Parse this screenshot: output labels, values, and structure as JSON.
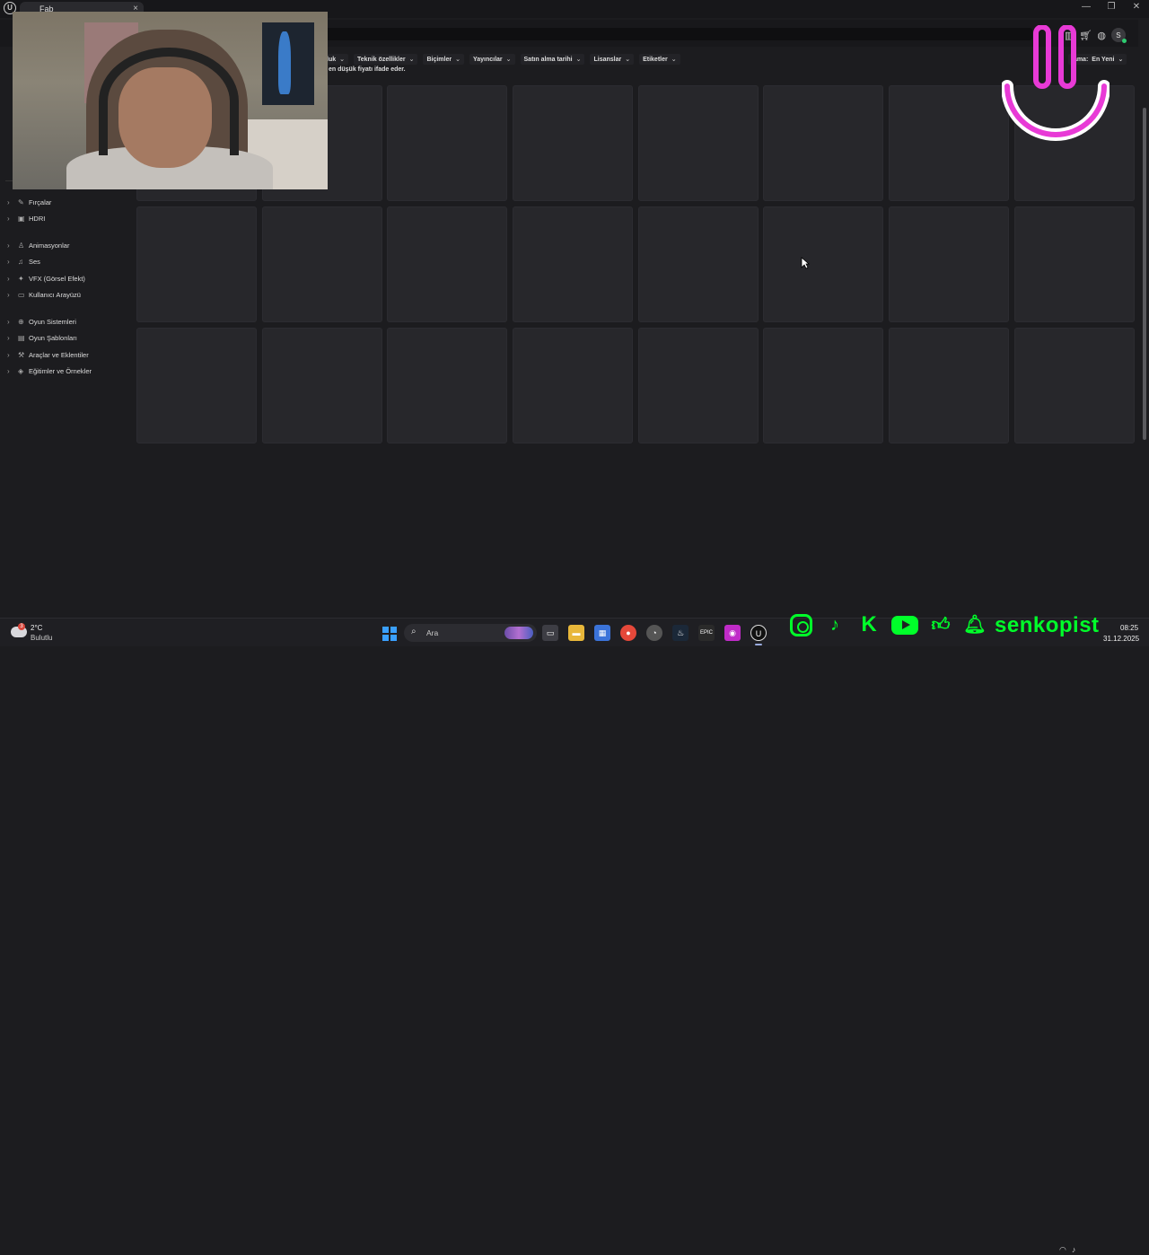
{
  "window": {
    "tab_title": "Fab",
    "tab_close": "×",
    "logo_text": "U",
    "controls": {
      "minimize": "—",
      "restore": "❐",
      "close": "✕"
    }
  },
  "header": {
    "icons": [
      "library-icon",
      "cart-icon",
      "globe-icon"
    ],
    "avatar_initial": "s"
  },
  "filters": [
    {
      "label": "luk"
    },
    {
      "label": "Teknik özellikler"
    },
    {
      "label": "Biçimler"
    },
    {
      "label": "Yayıncılar"
    },
    {
      "label": "Satın alma tarihi"
    },
    {
      "label": "Lisanslar"
    },
    {
      "label": "Etiketler"
    }
  ],
  "price_note": "en düşük fiyatı ifade eder.",
  "sort": {
    "prefix": "lama:",
    "value": "En Yeni"
  },
  "sidebar": {
    "groups": [
      [
        {
          "label": "Fırçalar",
          "icon": "brush-icon"
        },
        {
          "label": "HDRI",
          "icon": "image-icon"
        }
      ],
      [
        {
          "label": "Animasyonlar",
          "icon": "person-icon"
        },
        {
          "label": "Ses",
          "icon": "music-icon"
        },
        {
          "label": "VFX (Görsel Efekt)",
          "icon": "sparkle-icon"
        },
        {
          "label": "Kullanıcı Arayüzü",
          "icon": "monitor-icon"
        }
      ],
      [
        {
          "label": "Oyun Sistemleri",
          "icon": "gamepad-icon"
        },
        {
          "label": "Oyun Şablonları",
          "icon": "template-icon"
        },
        {
          "label": "Araçlar ve Eklentiler",
          "icon": "tools-icon"
        },
        {
          "label": "Eğitimler ve Örnekler",
          "icon": "education-icon"
        }
      ]
    ]
  },
  "grid": {
    "rows": 3,
    "columns": 8
  },
  "taskbar": {
    "weather_temp": "2°C",
    "weather_desc": "Bulutlu",
    "weather_badge": "3",
    "search_placeholder": "Ara",
    "apps": [
      "task-view",
      "file-explorer",
      "store",
      "chrome",
      "app-red-dot",
      "steam",
      "epic-games",
      "app-pink",
      "unreal-engine"
    ],
    "time": "08:25",
    "date": "31.12.2025"
  },
  "overlay": {
    "brand": "senkopist",
    "socials": [
      "instagram-icon",
      "tiktok-icon",
      "kick-icon",
      "youtube-icon",
      "thumbs-up-icon",
      "bell-icon"
    ]
  },
  "colors": {
    "accent_green": "#00ff2a",
    "smiley_pink": "#e83ad6",
    "card_bg": "#27272b",
    "page_bg": "#1c1c1f"
  }
}
